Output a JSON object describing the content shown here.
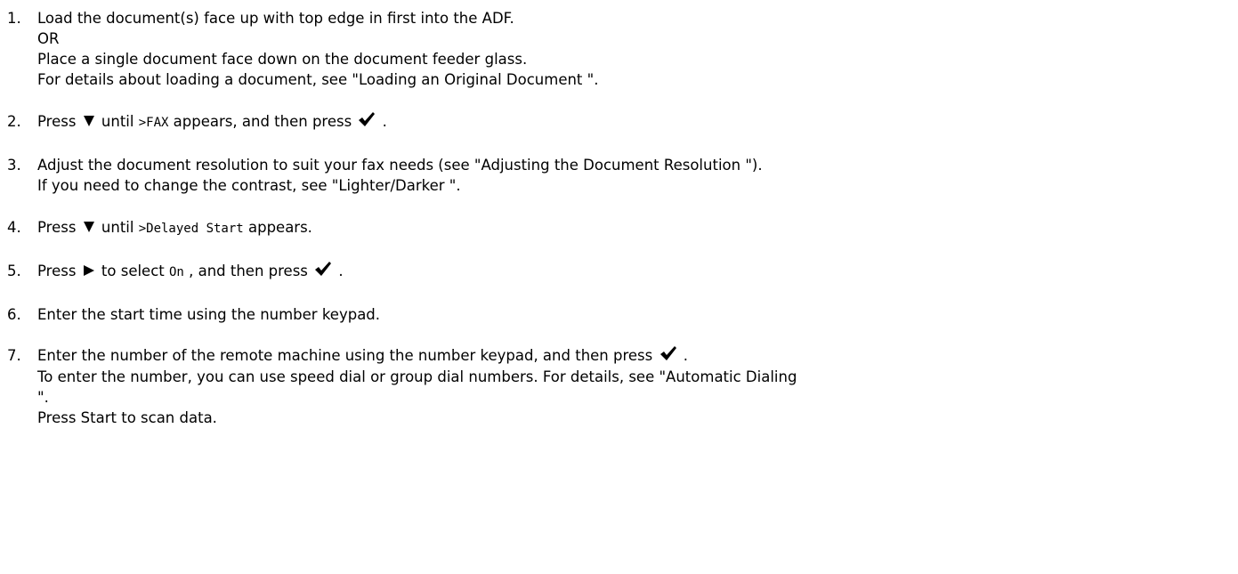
{
  "steps": [
    {
      "number": "1.",
      "lines": [
        "Load the document(s) face up with top edge in first into the ADF.",
        "OR",
        "Place a single document face down on the document feeder glass.",
        "For details about loading a document, see \"Loading an Original Document \"."
      ]
    },
    {
      "number": "2.",
      "t1": "Press ",
      "t2": " until ",
      "code": ">FAX",
      "t3": " appears, and then press ",
      "t4": " ."
    },
    {
      "number": "3.",
      "lines": [
        "Adjust the document resolution to suit your fax needs (see \"Adjusting the Document Resolution \").",
        "If you need to change the contrast, see \"Lighter/Darker \"."
      ]
    },
    {
      "number": "4.",
      "t1": "Press ",
      "t2": " until ",
      "code": ">Delayed Start",
      "t3": " appears."
    },
    {
      "number": "5.",
      "t1": "Press ",
      "t2": " to select ",
      "code": "On",
      "t3": " , and then press ",
      "t4": " ."
    },
    {
      "number": "6.",
      "text": "Enter the start time using the number keypad."
    },
    {
      "number": "7.",
      "line1_a": "Enter the number of the remote machine using the number keypad, and then press ",
      "line1_b": " .",
      "line2": "To enter the number, you can use speed dial or group dial numbers. For details, see \"Automatic Dialing",
      "line3": "\".",
      "line4": "Press Start to scan data."
    }
  ],
  "icons": {
    "down": "down-triangle-icon",
    "right": "right-triangle-icon",
    "check": "checkmark-icon"
  }
}
